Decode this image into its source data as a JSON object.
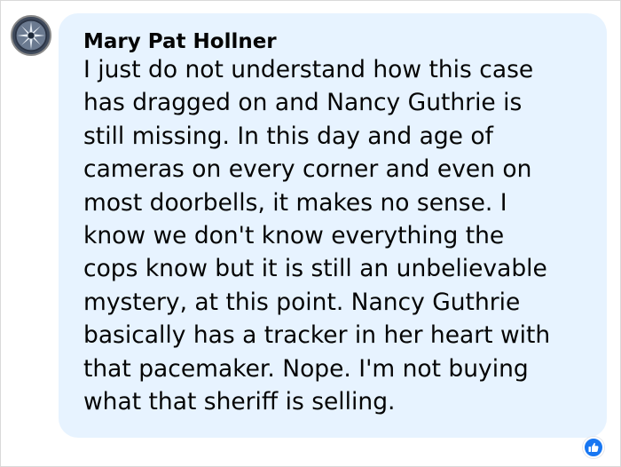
{
  "comment": {
    "author": "Mary Pat Hollner",
    "text_lines": [
      "I just do not understand how this case",
      "has dragged on and Nancy Guthrie is",
      "still missing. In this day and age of",
      "cameras on every corner and even on",
      "most doorbells, it makes no sense. I",
      "know we don't know everything the",
      "cops know but it is still an unbelievable",
      "mystery, at this point. Nancy Guthrie",
      "basically has a tracker in her heart with",
      "that pacemaker. Nope. I'm not buying",
      "what that sheriff is selling."
    ]
  },
  "reaction": {
    "icon": "thumbs-up-icon",
    "color": "#1877f2"
  },
  "colors": {
    "bubble": "#e7f3ff",
    "text": "#050505",
    "border": "#d9d9d9"
  }
}
